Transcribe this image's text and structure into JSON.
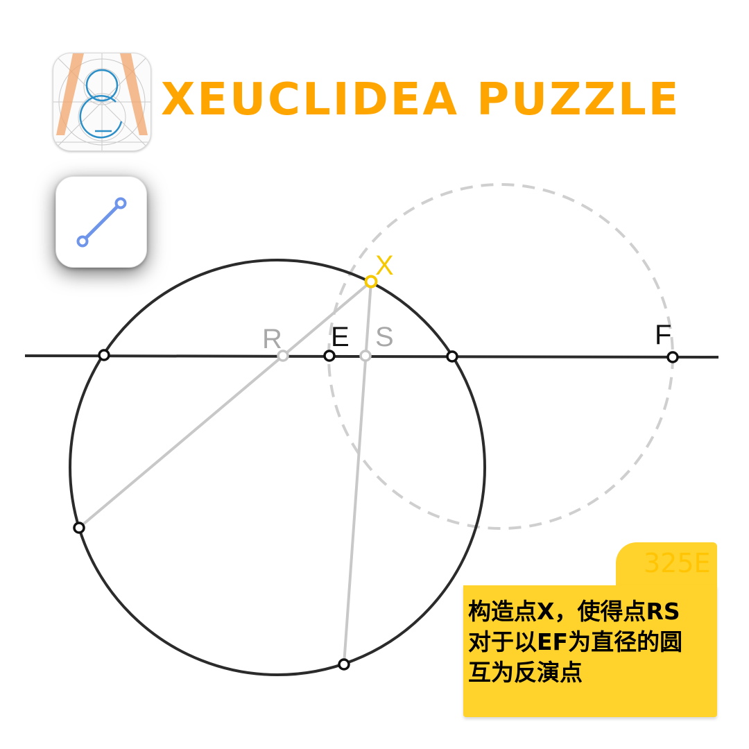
{
  "header": {
    "app_icon": "xeuclidea-icon",
    "title": "XEUCLIDEA PUZZLE"
  },
  "toolbar": {
    "active_tool_icon": "line-segment-icon"
  },
  "diagram": {
    "labels": {
      "X": "X",
      "R": "R",
      "E": "E",
      "S": "S",
      "F": "F"
    }
  },
  "task_card": {
    "code": "325E",
    "lines": [
      "构造点X，使得点RS",
      "对于以EF为直径的圆",
      "互为反演点"
    ]
  },
  "colors": {
    "title": "#ffa500",
    "highlight_point": "#f5c800",
    "tool_accent": "#6f95ea",
    "note_background": "#ffd22c",
    "construction_gray": "#c8c8c8",
    "main_stroke": "#2b2b2b"
  }
}
